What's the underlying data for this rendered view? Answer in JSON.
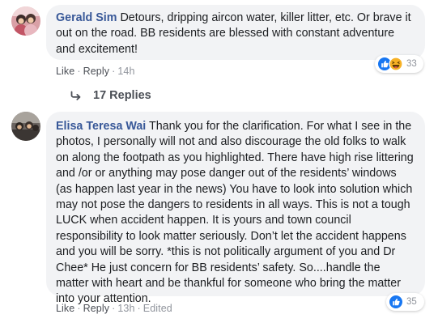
{
  "comments": [
    {
      "author": "Gerald Sim",
      "text": "Detours, dripping aircon water, killer litter, etc. Or brave it out on the road. BB residents are blessed with constant adventure and excitement!",
      "actions": {
        "like": "Like",
        "reply": "Reply",
        "time": "14h"
      },
      "reactions": {
        "types": [
          "like-icon",
          "haha-icon"
        ],
        "count": "33"
      },
      "reply_thread": {
        "label": "17 Replies"
      }
    },
    {
      "author": "Elisa Teresa Wai",
      "text": "Thank you for the clarification. For what I see in the photos, I personally will not and also discourage the old folks to walk on along the footpath as you highlighted. There have high rise littering and /or or anything may pose danger out of the residents’ windows (as happen last year in the news) You have to look into solution which may not pose the dangers to residents in all ways. This is not a tough LUCK when accident happen. It is yours and town council responsibility to look matter seriously. Don’t let the accident happens and you will be sorry. *this is not politically argument of you and Dr Chee* He just concern for BB residents’ safety. So....handle the matter with heart and be thankful for someone who bring the matter into your attention.",
      "actions": {
        "like": "Like",
        "reply": "Reply",
        "time": "13h",
        "edited": "Edited"
      },
      "reactions": {
        "types": [
          "like-icon"
        ],
        "count": "35"
      }
    }
  ],
  "colors": {
    "author": "#385898",
    "bubble": "#f2f3f5",
    "like_blue": "#1877f2",
    "haha_yellow": "#f7b125"
  }
}
